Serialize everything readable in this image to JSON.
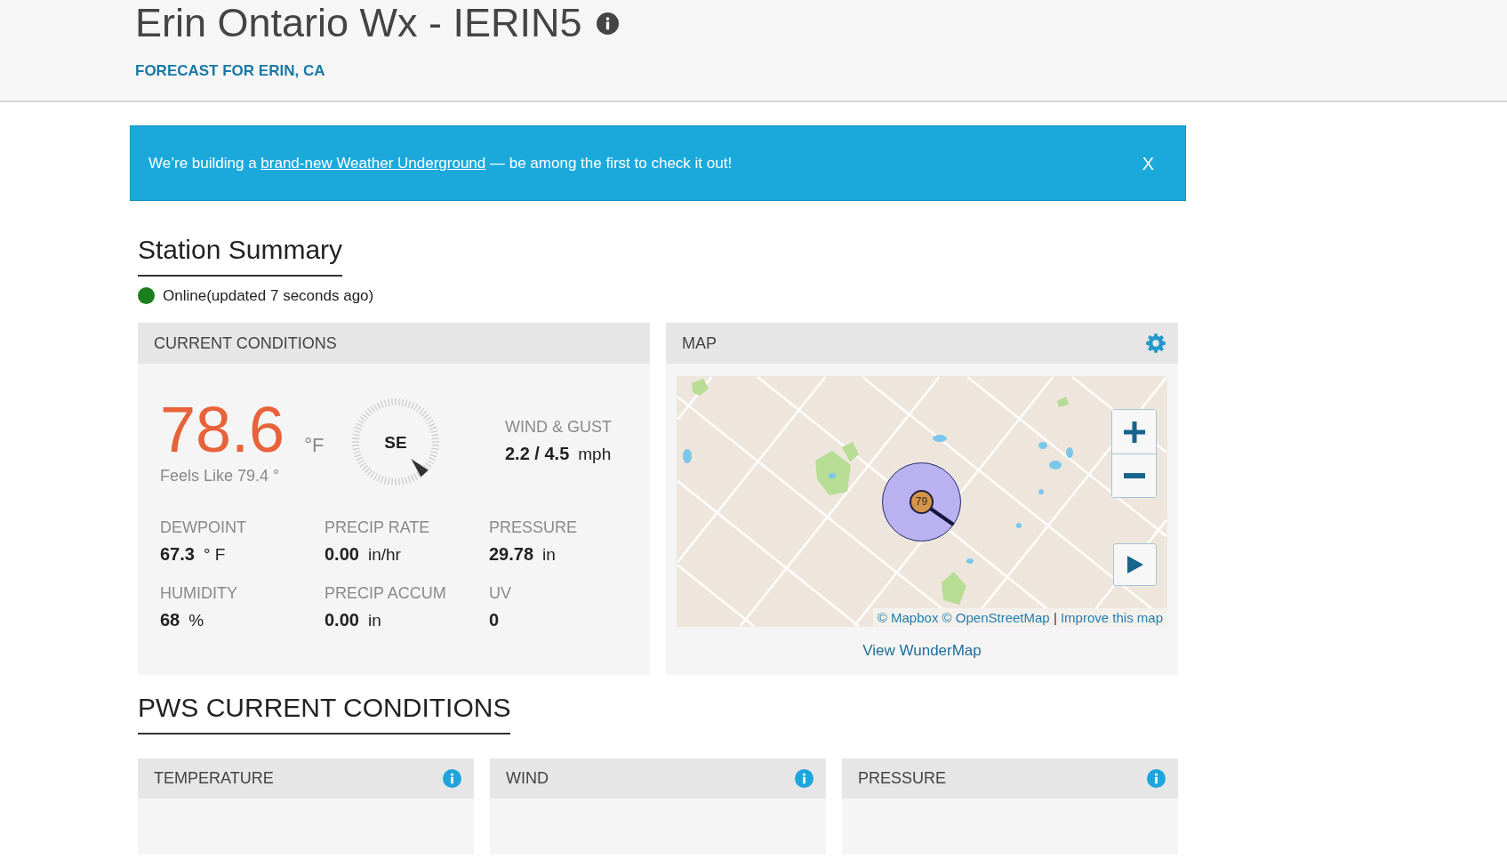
{
  "header": {
    "title": "Erin Ontario Wx - IERIN5",
    "forecast_link": "FORECAST FOR ERIN, CA"
  },
  "banner": {
    "before": "We’re building a",
    "link": "brand-new Weather Underground",
    "after": "— be among the first to check it out!",
    "close": "X"
  },
  "station_summary": {
    "heading": "Station Summary",
    "status": {
      "online": true,
      "text": "Online(updated 7 seconds ago)"
    }
  },
  "current_conditions": {
    "title": "CURRENT CONDITIONS",
    "temperature": "78.6",
    "temperature_unit": "°F",
    "feels_like": "Feels Like 79.4 °",
    "wind_direction": "SE",
    "wind": {
      "label": "WIND & GUST",
      "value": "2.2 / 4.5",
      "unit": "mph"
    },
    "metrics": [
      {
        "label": "DEWPOINT",
        "value": "67.3",
        "unit": "° F"
      },
      {
        "label": "PRECIP RATE",
        "value": "0.00",
        "unit": "in/hr"
      },
      {
        "label": "PRESSURE",
        "value": "29.78",
        "unit": "in"
      },
      {
        "label": "HUMIDITY",
        "value": "68",
        "unit": "%"
      },
      {
        "label": "PRECIP ACCUM",
        "value": "0.00",
        "unit": "in"
      },
      {
        "label": "UV",
        "value": "0"
      }
    ]
  },
  "map": {
    "title": "MAP",
    "marker": "79",
    "attribution": [
      {
        "kind": "link",
        "text": "© Mapbox"
      },
      {
        "kind": "link",
        "text": "© OpenStreetMap"
      },
      {
        "kind": "separator",
        "text": "|"
      },
      {
        "kind": "link",
        "text": "Improve this map"
      }
    ],
    "view_link": "View WunderMap"
  },
  "pws_current_conditions": {
    "heading": "PWS CURRENT CONDITIONS",
    "panels": [
      {
        "title": "TEMPERATURE"
      },
      {
        "title": "WIND"
      },
      {
        "title": "PRESSURE"
      }
    ]
  }
}
